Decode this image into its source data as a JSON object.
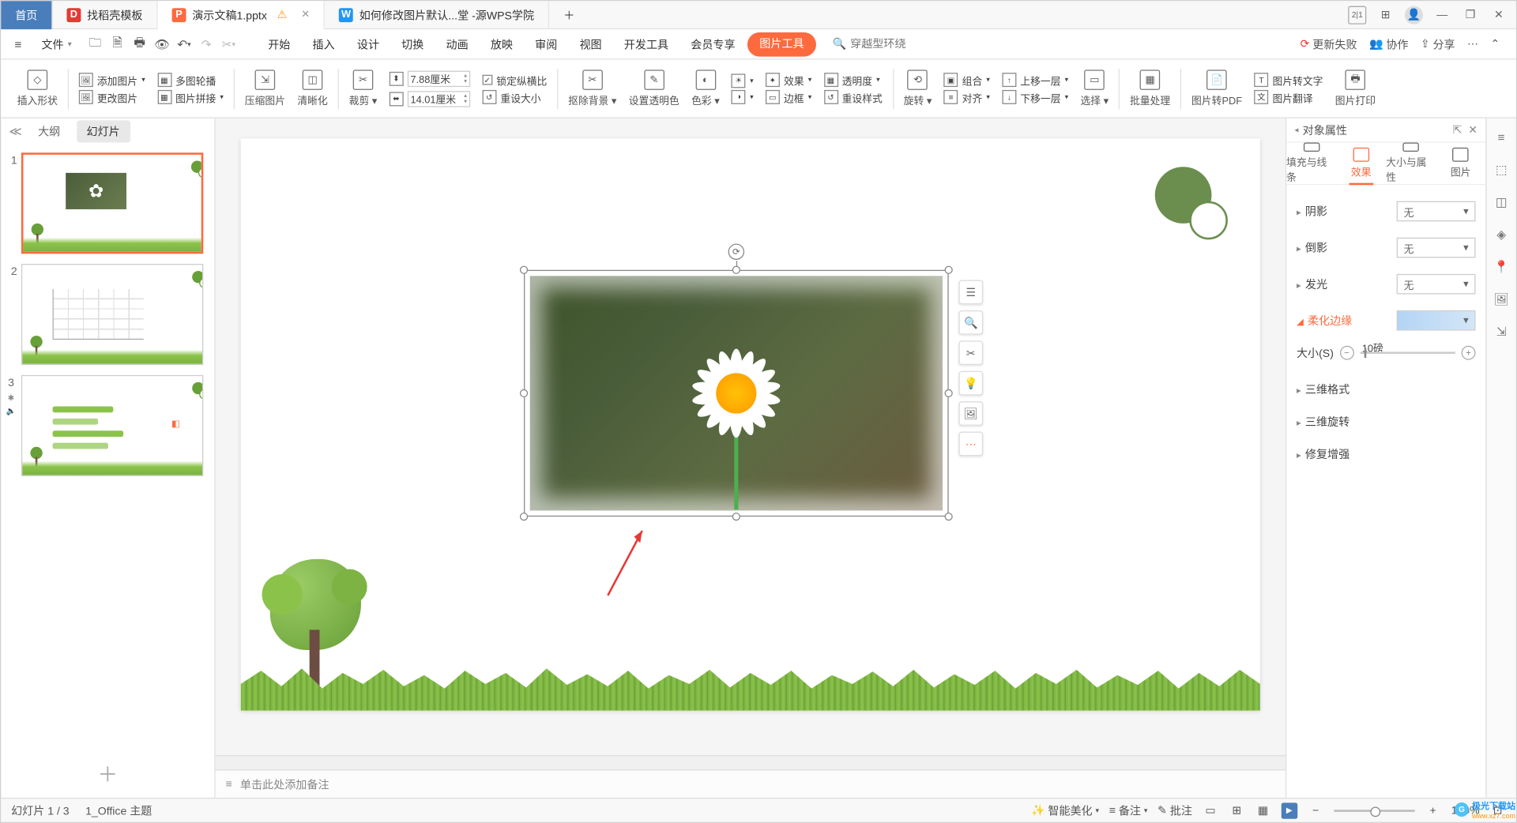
{
  "tabs": {
    "home": "首页",
    "t1": "找稻壳模板",
    "t2": "演示文稿1.pptx",
    "t3": "如何修改图片默认...堂 -源WPS学院"
  },
  "menubar": {
    "file": "文件",
    "items": [
      "开始",
      "插入",
      "设计",
      "切换",
      "动画",
      "放映",
      "审阅",
      "视图",
      "开发工具",
      "会员专享",
      "图片工具"
    ],
    "search_ph": "穿越型环绕",
    "right": {
      "fail": "更新失败",
      "coop": "协作",
      "share": "分享"
    }
  },
  "ribbon": {
    "insertShape": "插入形状",
    "addImg": "添加图片",
    "multiCarousel": "多图轮播",
    "changeImg": "更改图片",
    "imgJoin": "图片拼接",
    "compress": "压缩图片",
    "clarify": "清晰化",
    "crop": "裁剪",
    "w": "7.88厘米",
    "h": "14.01厘米",
    "lock": "锁定纵横比",
    "resetSize": "重设大小",
    "rmBg": "抠除背景",
    "setTrans": "设置透明色",
    "color": "色彩",
    "effect": "效果",
    "trans": "透明度",
    "border": "边框",
    "resetStyle": "重设样式",
    "rotate": "旋转",
    "combine": "组合",
    "upLayer": "上移一层",
    "align": "对齐",
    "downLayer": "下移一层",
    "select": "选择",
    "batch": "批量处理",
    "toPdf": "图片转PDF",
    "toText": "图片转文字",
    "translate": "图片翻译",
    "print": "图片打印"
  },
  "sidebar": {
    "outline": "大纲",
    "slides": "幻灯片"
  },
  "thumb_icons": {
    "anim": "✱",
    "sound": "🔈",
    "link": "◧"
  },
  "canvas": {
    "notes_ph": "单击此处添加备注"
  },
  "ctx_tools": [
    "layers",
    "zoom",
    "crop",
    "idea",
    "img",
    "more"
  ],
  "prop": {
    "title": "对象属性",
    "tabs": [
      "填充与线条",
      "效果",
      "大小与属性",
      "图片"
    ],
    "shadow": "阴影",
    "reflect": "倒影",
    "glow": "发光",
    "soft": "柔化边缘",
    "size_s": "大小(S)",
    "size_val": "10磅",
    "none": "无",
    "fmt3d": "三维格式",
    "rot3d": "三维旋转",
    "repair": "修复增强"
  },
  "status": {
    "page": "幻灯片 1 / 3",
    "theme": "1_Office 主题",
    "beautify": "智能美化",
    "backup": "备注",
    "annotate": "批注",
    "zoom": "100%"
  },
  "watermark": {
    "name": "极光下载站",
    "url": "www.xz7.com"
  }
}
